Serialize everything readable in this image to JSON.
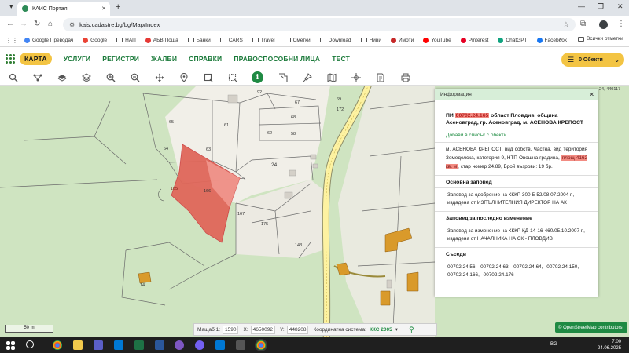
{
  "browser": {
    "tab_title": "КАИС Портал",
    "url": "kais.cadastre.bg/bg/Map/Index",
    "bookmarks": [
      {
        "label": "Google Преводач",
        "icon": "google-translate-icon"
      },
      {
        "label": "Google",
        "icon": "google-icon"
      },
      {
        "label": "НАП",
        "icon": "folder-icon"
      },
      {
        "label": "АБВ Поща",
        "icon": "mail-icon"
      },
      {
        "label": "Банки",
        "icon": "folder-icon"
      },
      {
        "label": "CARS",
        "icon": "folder-icon"
      },
      {
        "label": "Travel",
        "icon": "folder-icon"
      },
      {
        "label": "Сметки",
        "icon": "folder-icon"
      },
      {
        "label": "Download",
        "icon": "folder-icon"
      },
      {
        "label": "Ниви",
        "icon": "folder-icon"
      },
      {
        "label": "Имоти",
        "icon": "imoti-icon"
      },
      {
        "label": "YouTube",
        "icon": "youtube-icon"
      },
      {
        "label": "Pinterest",
        "icon": "pinterest-icon"
      },
      {
        "label": "ChatGPT",
        "icon": "chatgpt-icon"
      },
      {
        "label": "Facebook",
        "icon": "facebook-icon"
      }
    ],
    "bookmarks_more": "»",
    "all_bookmarks": "Всички отметки"
  },
  "site_nav": {
    "items": [
      "КАРТА",
      "УСЛУГИ",
      "РЕГИСТРИ",
      "ЖАЛБИ",
      "СПРАВКИ",
      "ПРАВОСПОСОБНИ ЛИЦА",
      "ТЕСТ"
    ],
    "objects_label": "0 Обекти"
  },
  "map": {
    "parcel_labels": [
      "92",
      "67",
      "68",
      "69",
      "172",
      "61",
      "62",
      "58",
      "65",
      "64",
      "63",
      "24",
      "165",
      "166",
      "167",
      "175",
      "143",
      "14"
    ],
    "corner_coord": "24, 440117"
  },
  "info_panel": {
    "header": "Информация",
    "title_prefix": "ПИ ",
    "parcel_id": "00702.24.165",
    "title_rest": " област Пловдив, община Асеновград, гр. Асеновград, м. АСЕНОВА КРЕПОСТ",
    "add_to_list": "Добави в списък с обекти",
    "desc_part1": "м. АСЕНОВА КРЕПОСТ, вид собств. Частна, вид територия Земеделска, категория 9, НТП Овощна градина, ",
    "area_highlight": "площ 4162 кв. м",
    "desc_part2": ", стар номер 24.89, Брой възрови: 19 бр.",
    "section1_title": "Основна заповед",
    "section1_text": "Заповед за одобрение на КККР 300-5-52/08.07.2004 г., издадена от ИЗПЪЛНИТЕЛНИЯ ДИРЕКТОР НА АК",
    "section2_title": "Заповед за последно изменение",
    "section2_text": "Заповед за изменение на КККР КД-14-16-460/05.10.2007 г., издадена от НАЧАЛНИКА НА СК - ПЛОВДИВ",
    "section3_title": "Съседи",
    "neighbors": "00702.24.56, 00702.24.63, 00702.24.64, 00702.24.150, 00702.24.166, 00702.24.176"
  },
  "status_bar": {
    "scale_label": "Мащаб 1:",
    "scale_value": "1590",
    "x_label": "X:",
    "x_value": "4650092",
    "y_label": "Y:",
    "y_value": "448208",
    "coord_system_label": "Координатна система:",
    "coord_system_value": "ККС 2005"
  },
  "scale_text": "50 m",
  "osm_attribution": "© OpenStreetMap contributors.",
  "taskbar": {
    "lang": "BG",
    "time": "7:00",
    "date": "24.06.2025"
  }
}
